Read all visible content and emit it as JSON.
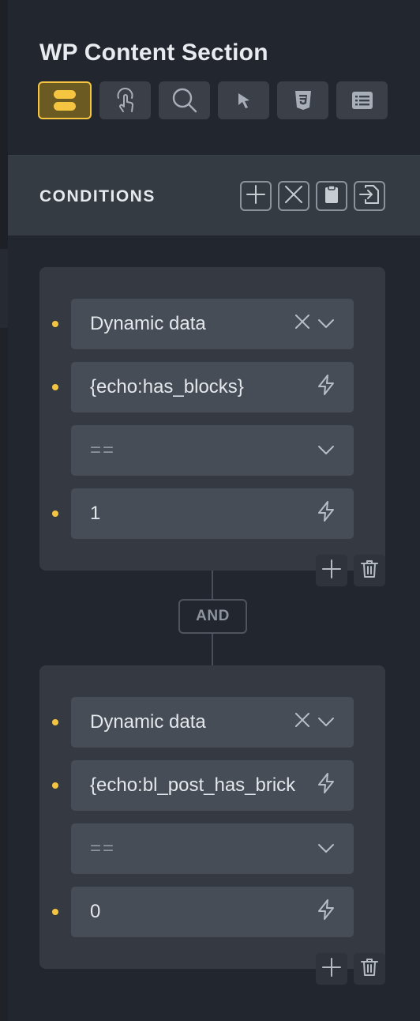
{
  "panel": {
    "title": "WP Content Section",
    "toolbar": [
      {
        "name": "layout-icon",
        "active": true
      },
      {
        "name": "interaction-icon",
        "active": false
      },
      {
        "name": "search-icon",
        "active": false
      },
      {
        "name": "cursor-icon",
        "active": false
      },
      {
        "name": "css3-icon",
        "active": false
      },
      {
        "name": "list-icon",
        "active": false
      }
    ]
  },
  "conditions": {
    "heading": "CONDITIONS",
    "actions": [
      "plus-icon",
      "close-icon",
      "clipboard-icon",
      "import-icon"
    ],
    "connector_label": "AND",
    "groups": [
      {
        "type_label": "Dynamic data",
        "tag_value": "{echo:has_blocks}",
        "operator_value": "==",
        "compare_value": "1"
      },
      {
        "type_label": "Dynamic data",
        "tag_value": "{echo:bl_post_has_brick",
        "operator_value": "==",
        "compare_value": "0"
      }
    ]
  },
  "colors": {
    "accent": "#f5c542",
    "background": "#22262e",
    "row": "#464d56"
  }
}
